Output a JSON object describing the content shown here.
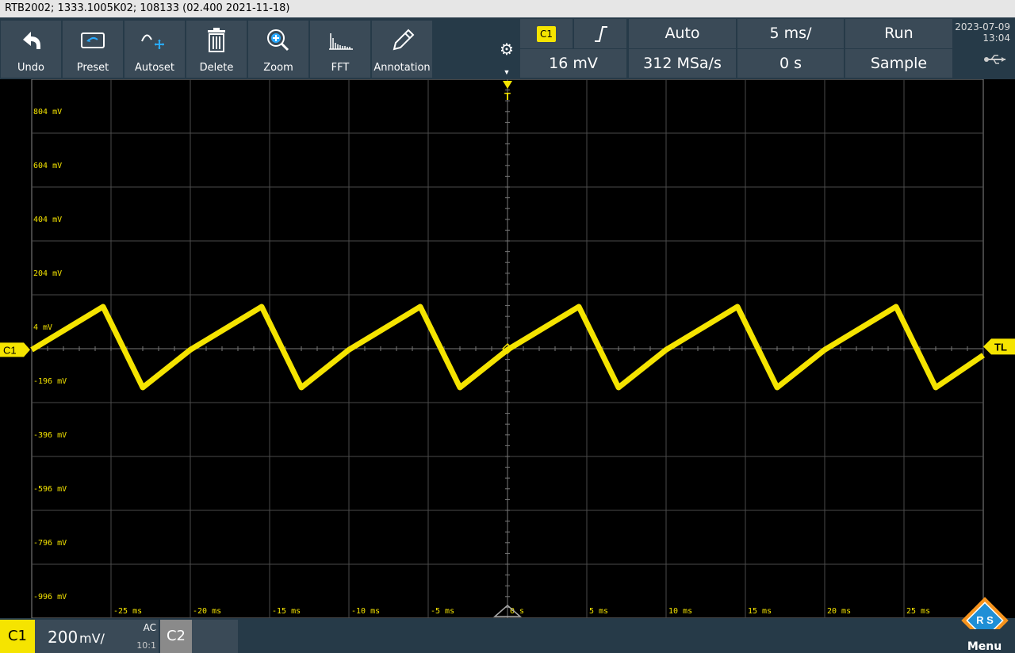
{
  "title_bar": {
    "text": "RTB2002; 1333.1005K02; 108133 (02.400 2021-11-18)"
  },
  "toolbar": {
    "buttons": [
      {
        "label": "Undo",
        "icon": "undo-icon"
      },
      {
        "label": "Preset",
        "icon": "preset-icon"
      },
      {
        "label": "Autoset",
        "icon": "autoset-icon"
      },
      {
        "label": "Delete",
        "icon": "trash-icon"
      },
      {
        "label": "Zoom",
        "icon": "zoom-icon"
      },
      {
        "label": "FFT",
        "icon": "fft-icon"
      },
      {
        "label": "Annotation",
        "icon": "pen-icon"
      }
    ],
    "settings_icon": "gear-icon"
  },
  "status": {
    "trigger_source": "C1",
    "trigger_slope_icon": "rising-edge-icon",
    "trigger_mode": "Auto",
    "timebase": "5 ms/",
    "run_state": "Run",
    "trigger_level": "16 mV",
    "sample_rate": "312 MSa/s",
    "horizontal_position": "0 s",
    "acquisition_mode": "Sample",
    "date": "2023-07-09",
    "time": "13:04",
    "usb_icon": "usb-icon"
  },
  "screen": {
    "y_labels": [
      "804 mV",
      "604 mV",
      "404 mV",
      "204 mV",
      "4 mV",
      "-196 mV",
      "-396 mV",
      "-596 mV",
      "-796 mV",
      "-996 mV"
    ],
    "x_labels": [
      "-25 ms",
      "-20 ms",
      "-15 ms",
      "-10 ms",
      "-5 ms",
      "0 s",
      "5 ms",
      "10 ms",
      "15 ms",
      "20 ms",
      "25 ms"
    ],
    "trigger_marker": "T",
    "channel_marker": "C1",
    "trigger_level_marker": "TL",
    "trace_color": "#f5e400",
    "grid_color": "#4a4a4a"
  },
  "chart_data": {
    "type": "line",
    "xlabel": "",
    "ylabel": "",
    "xlim": [
      -30,
      30
    ],
    "ylim": [
      -996,
      1004
    ],
    "series": [
      {
        "x": [
          -30,
          -25.5,
          -23,
          -20,
          -15.5,
          -13,
          -10,
          -5.5,
          -3,
          0,
          4.5,
          7,
          10,
          14.5,
          17,
          20,
          24.5,
          27,
          30
        ],
        "values": [
          0,
          160,
          -140,
          0,
          160,
          -140,
          0,
          160,
          -140,
          0,
          160,
          -140,
          0,
          160,
          -140,
          0,
          160,
          -140,
          -20
        ]
      }
    ]
  },
  "bottom": {
    "ch1_label": "C1",
    "ch1_scale_value": "200",
    "ch1_scale_unit": "mV/",
    "ch1_coupling": "AC",
    "ch1_probe": "10:1",
    "ch2_label": "C2",
    "menu_label": "Menu",
    "logo_text": "R S",
    "logo_colors": [
      "#f7941d",
      "#1f8fd6"
    ]
  }
}
